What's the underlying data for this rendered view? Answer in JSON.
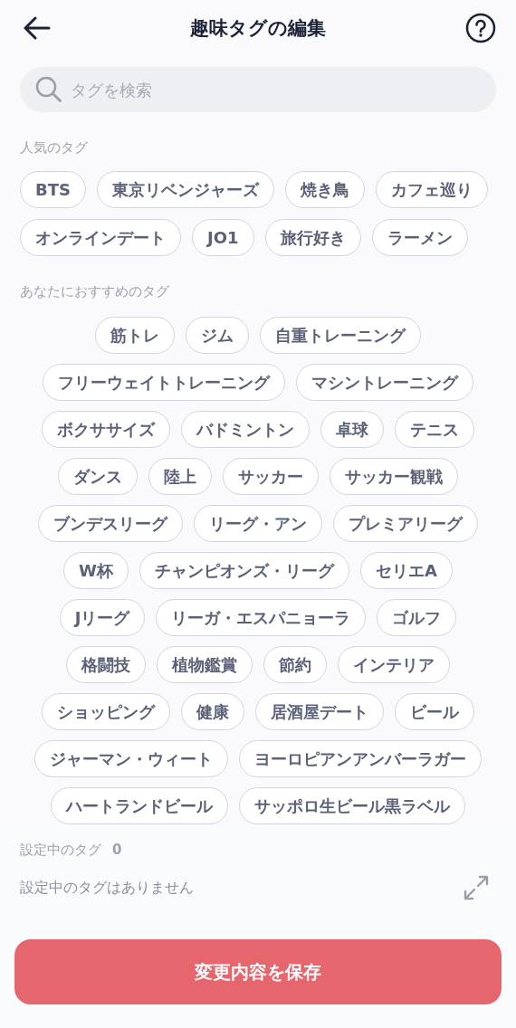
{
  "header": {
    "title": "趣味タグの編集"
  },
  "search": {
    "placeholder": "タグを検索"
  },
  "popular": {
    "label": "人気のタグ",
    "rows": [
      [
        "BTS",
        "東京リベンジャーズ",
        "焼き鳥",
        "カフェ巡り"
      ],
      [
        "オンラインデート",
        "JO1",
        "旅行好き",
        "ラーメン"
      ]
    ]
  },
  "recommended": {
    "label": "あなたにおすすめのタグ",
    "rows": [
      [
        "筋トレ",
        "ジム",
        "自重トレーニング"
      ],
      [
        "フリーウェイトトレーニング",
        "マシントレーニング"
      ],
      [
        "ボクササイズ",
        "バドミントン",
        "卓球",
        "テニス"
      ],
      [
        "ダンス",
        "陸上",
        "サッカー",
        "サッカー観戦"
      ],
      [
        "ブンデスリーグ",
        "リーグ・アン",
        "プレミアリーグ"
      ],
      [
        "W杯",
        "チャンピオンズ・リーグ",
        "セリエA"
      ],
      [
        "Jリーグ",
        "リーガ・エスパニョーラ",
        "ゴルフ"
      ],
      [
        "格闘技",
        "植物鑑賞",
        "節約",
        "インテリア"
      ],
      [
        "ショッピング",
        "健康",
        "居酒屋デート",
        "ビール"
      ],
      [
        "ジャーマン・ウィート",
        "ヨーロピアンアンバーラガー"
      ],
      [
        "ハートランドビール",
        "サッポロ生ビール黒ラベル"
      ]
    ]
  },
  "selected": {
    "label": "設定中のタグ",
    "count": "0",
    "empty_message": "設定中のタグはありません"
  },
  "save_button": "変更内容を保存"
}
